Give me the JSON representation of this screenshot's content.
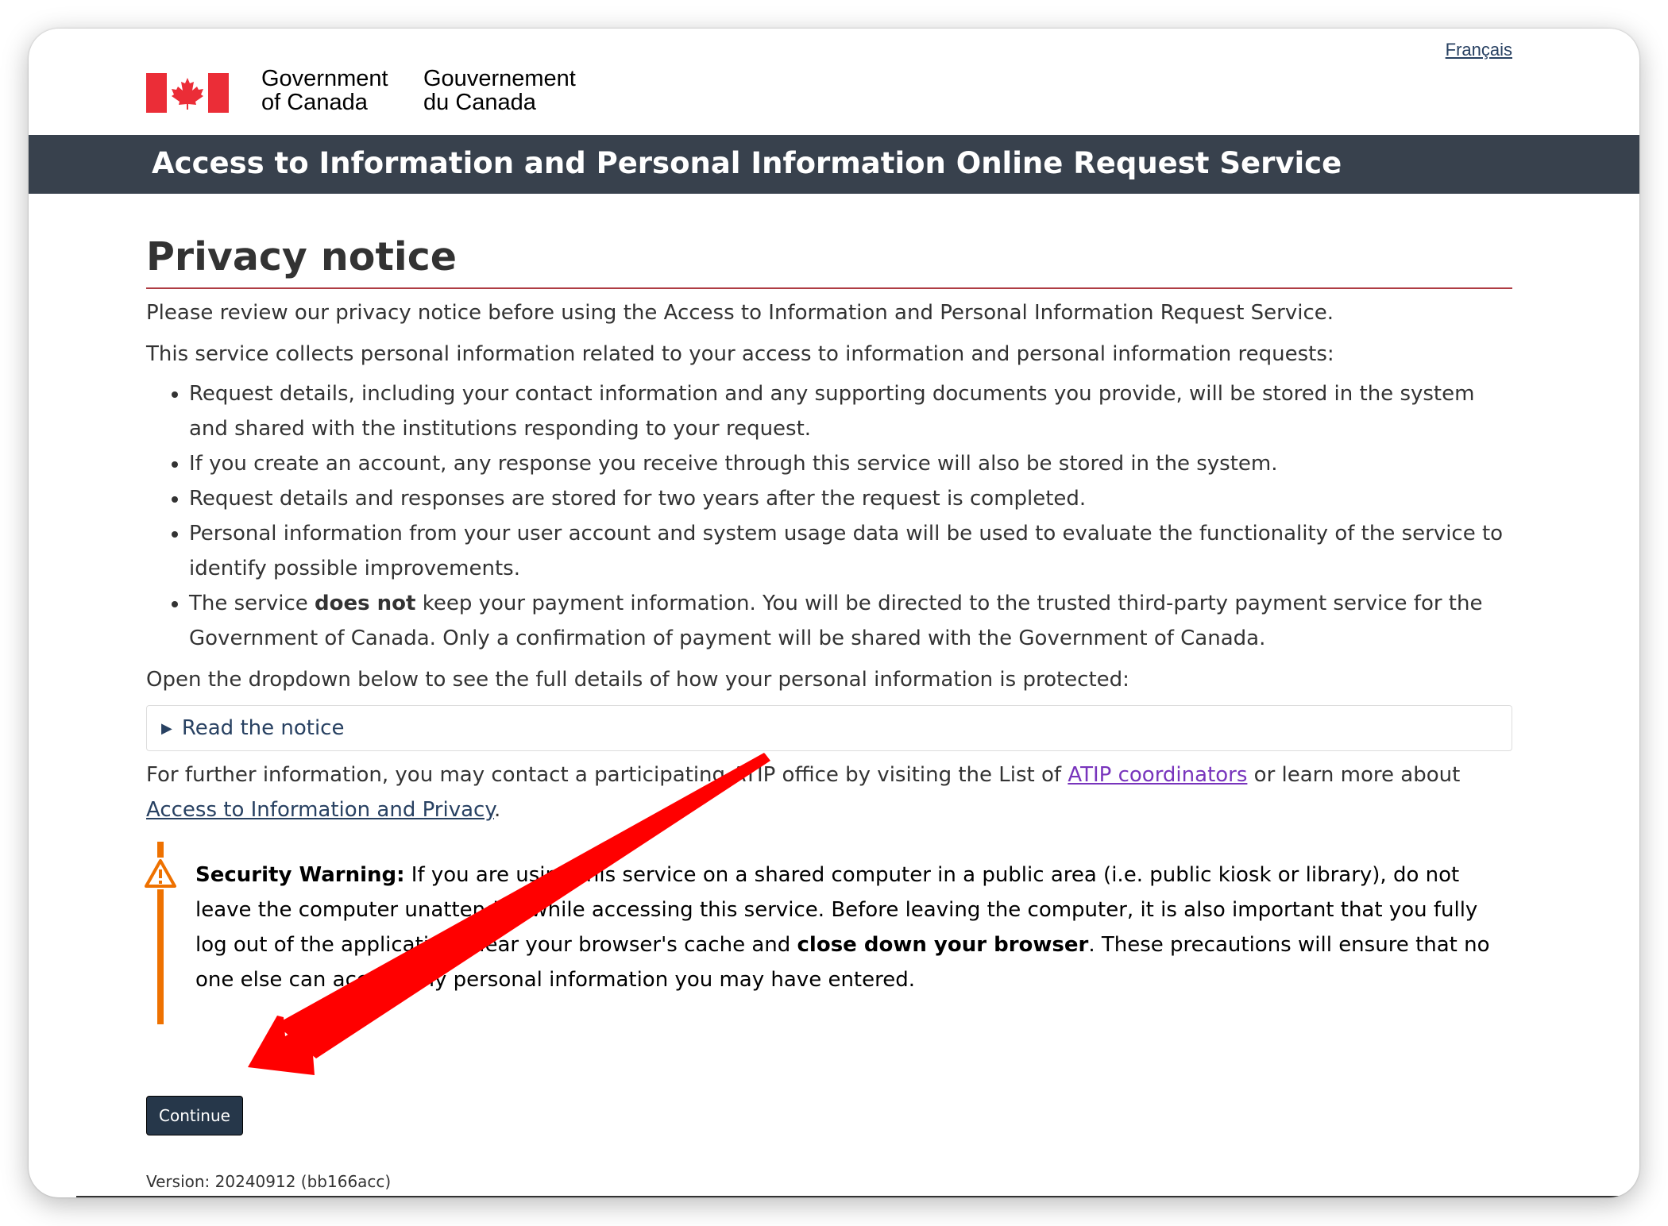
{
  "header": {
    "language_link": "Français",
    "wordmark_en_line1": "Government",
    "wordmark_en_line2": "of Canada",
    "wordmark_fr_line1": "Gouvernement",
    "wordmark_fr_line2": "du Canada",
    "service_title": "Access to Information and Personal Information Online Request Service"
  },
  "main": {
    "page_title": "Privacy notice",
    "intro": "Please review our privacy notice before using the Access to Information and Personal Information Request Service.",
    "collects": "This service collects personal information related to your access to information and personal information requests:",
    "bullets": {
      "b1": "Request details, including your contact information and any supporting documents you provide, will be stored in the system and shared with the institutions responding to your request.",
      "b2": "If you create an account, any response you receive through this service will also be stored in the system.",
      "b3": "Request details and responses are stored for two years after the request is completed.",
      "b4": "Personal information from your user account and system usage data will be used to evaluate the functionality of the service to identify possible improvements.",
      "b5_pre": "The service ",
      "b5_bold": "does not",
      "b5_post": " keep your payment information. You will be directed to the trusted third-party payment service for the Government of Canada. Only a confirmation of payment will be shared with the Government of Canada."
    },
    "dropdown_intro": "Open the dropdown below to see the full details of how your personal information is protected:",
    "details_summary": "Read the notice",
    "further_pre": "For further information, you may contact a participating ATIP office by visiting the List of ",
    "further_link1": "ATIP coordinators",
    "further_mid": " or learn more about ",
    "further_link2": "Access to Information and Privacy",
    "further_post": ".",
    "warning": {
      "label": "Security Warning:",
      "text1": " If you are using this service on a shared computer in a public area (i.e. public kiosk or library), do not leave the computer unattended while accessing this service. Before leaving the computer, it is also important that you fully log out of the application, clear your browser's cache and ",
      "bold2": "close down your browser",
      "text2": ". These precautions will ensure that no one else can access any personal information you may have entered."
    },
    "continue_label": "Continue",
    "version": "Version: 20240912 (bb166acc)"
  },
  "colors": {
    "title_bar": "#38414d",
    "link": "#284162",
    "visited_link": "#7834bc",
    "title_rule": "#af3c43",
    "warning": "#ee7100",
    "button": "#26374a",
    "flag_red": "#eb2d37",
    "annotation_arrow": "#ff0000"
  },
  "icons": {
    "warning": "warning-triangle-icon",
    "summary": "triangle-right-icon",
    "flag": "canada-flag-icon"
  }
}
